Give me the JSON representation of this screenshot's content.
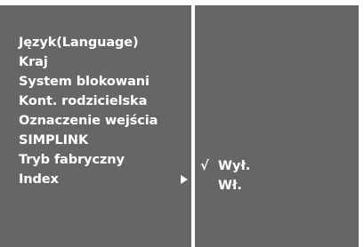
{
  "menu": {
    "items": [
      {
        "label": "Język(Language)"
      },
      {
        "label": "Kraj"
      },
      {
        "label": "System blokowani"
      },
      {
        "label": "Kont. rodzicielska"
      },
      {
        "label": "Oznaczenie wejścia"
      },
      {
        "label": "SIMPLINK"
      },
      {
        "label": "Tryb fabryczny"
      },
      {
        "label": "Index"
      }
    ],
    "selected_index": 7
  },
  "submenu": {
    "options": [
      {
        "label": "Wył.",
        "checked": true,
        "check_mark": "√"
      },
      {
        "label": "Wł.",
        "checked": false,
        "check_mark": ""
      }
    ]
  },
  "colors": {
    "panel": "#666666",
    "text": "#ffffff",
    "background": "#ffffff"
  }
}
